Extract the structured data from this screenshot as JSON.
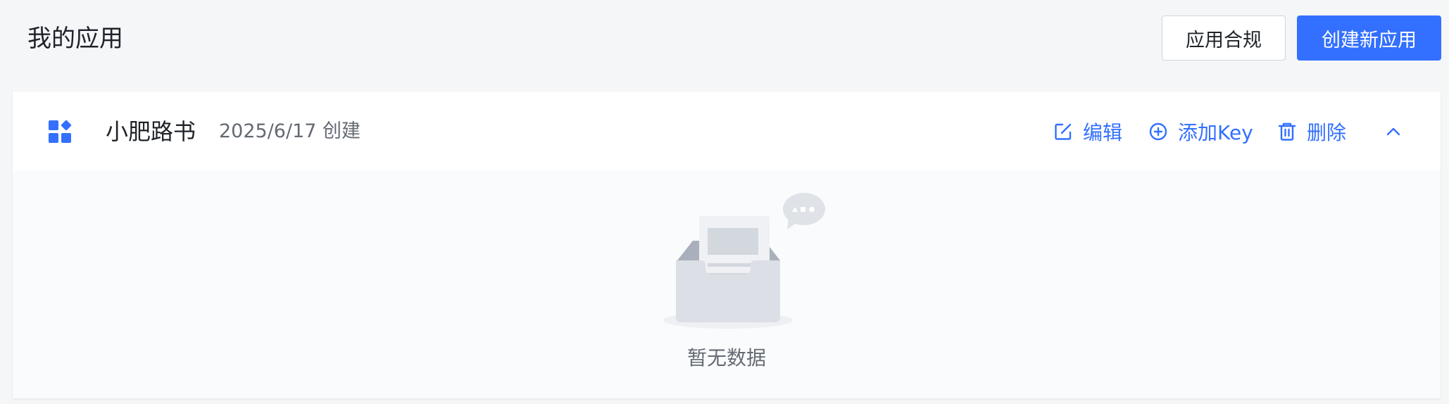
{
  "header": {
    "title": "我的应用",
    "compliance_label": "应用合规",
    "create_label": "创建新应用"
  },
  "app": {
    "name": "小肥路书",
    "created": "2025/6/17 创建",
    "icon": "apps-grid-icon",
    "actions": {
      "edit": "编辑",
      "add_key": "添加Key",
      "delete": "删除"
    }
  },
  "empty": {
    "text": "暂无数据"
  },
  "colors": {
    "accent": "#3370ff",
    "text_primary": "#1f2329",
    "text_secondary": "#646a73",
    "background": "#f5f6f8"
  }
}
